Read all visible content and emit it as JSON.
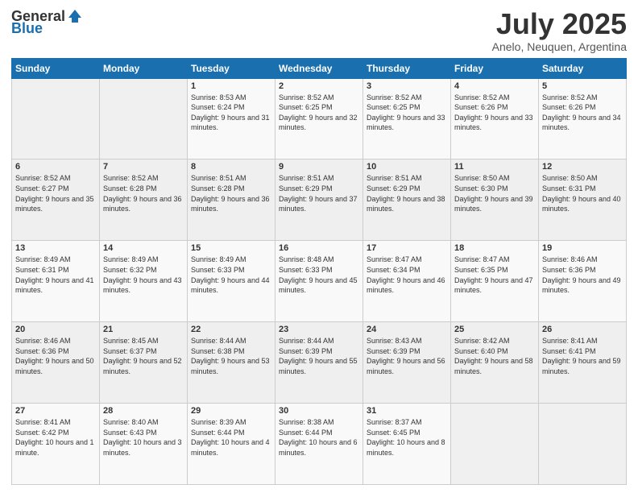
{
  "header": {
    "logo_general": "General",
    "logo_blue": "Blue",
    "title": "July 2025",
    "subtitle": "Anelo, Neuquen, Argentina"
  },
  "weekdays": [
    "Sunday",
    "Monday",
    "Tuesday",
    "Wednesday",
    "Thursday",
    "Friday",
    "Saturday"
  ],
  "weeks": [
    [
      {
        "day": "",
        "info": ""
      },
      {
        "day": "",
        "info": ""
      },
      {
        "day": "1",
        "info": "Sunrise: 8:53 AM\nSunset: 6:24 PM\nDaylight: 9 hours and 31 minutes."
      },
      {
        "day": "2",
        "info": "Sunrise: 8:52 AM\nSunset: 6:25 PM\nDaylight: 9 hours and 32 minutes."
      },
      {
        "day": "3",
        "info": "Sunrise: 8:52 AM\nSunset: 6:25 PM\nDaylight: 9 hours and 33 minutes."
      },
      {
        "day": "4",
        "info": "Sunrise: 8:52 AM\nSunset: 6:26 PM\nDaylight: 9 hours and 33 minutes."
      },
      {
        "day": "5",
        "info": "Sunrise: 8:52 AM\nSunset: 6:26 PM\nDaylight: 9 hours and 34 minutes."
      }
    ],
    [
      {
        "day": "6",
        "info": "Sunrise: 8:52 AM\nSunset: 6:27 PM\nDaylight: 9 hours and 35 minutes."
      },
      {
        "day": "7",
        "info": "Sunrise: 8:52 AM\nSunset: 6:28 PM\nDaylight: 9 hours and 36 minutes."
      },
      {
        "day": "8",
        "info": "Sunrise: 8:51 AM\nSunset: 6:28 PM\nDaylight: 9 hours and 36 minutes."
      },
      {
        "day": "9",
        "info": "Sunrise: 8:51 AM\nSunset: 6:29 PM\nDaylight: 9 hours and 37 minutes."
      },
      {
        "day": "10",
        "info": "Sunrise: 8:51 AM\nSunset: 6:29 PM\nDaylight: 9 hours and 38 minutes."
      },
      {
        "day": "11",
        "info": "Sunrise: 8:50 AM\nSunset: 6:30 PM\nDaylight: 9 hours and 39 minutes."
      },
      {
        "day": "12",
        "info": "Sunrise: 8:50 AM\nSunset: 6:31 PM\nDaylight: 9 hours and 40 minutes."
      }
    ],
    [
      {
        "day": "13",
        "info": "Sunrise: 8:49 AM\nSunset: 6:31 PM\nDaylight: 9 hours and 41 minutes."
      },
      {
        "day": "14",
        "info": "Sunrise: 8:49 AM\nSunset: 6:32 PM\nDaylight: 9 hours and 43 minutes."
      },
      {
        "day": "15",
        "info": "Sunrise: 8:49 AM\nSunset: 6:33 PM\nDaylight: 9 hours and 44 minutes."
      },
      {
        "day": "16",
        "info": "Sunrise: 8:48 AM\nSunset: 6:33 PM\nDaylight: 9 hours and 45 minutes."
      },
      {
        "day": "17",
        "info": "Sunrise: 8:47 AM\nSunset: 6:34 PM\nDaylight: 9 hours and 46 minutes."
      },
      {
        "day": "18",
        "info": "Sunrise: 8:47 AM\nSunset: 6:35 PM\nDaylight: 9 hours and 47 minutes."
      },
      {
        "day": "19",
        "info": "Sunrise: 8:46 AM\nSunset: 6:36 PM\nDaylight: 9 hours and 49 minutes."
      }
    ],
    [
      {
        "day": "20",
        "info": "Sunrise: 8:46 AM\nSunset: 6:36 PM\nDaylight: 9 hours and 50 minutes."
      },
      {
        "day": "21",
        "info": "Sunrise: 8:45 AM\nSunset: 6:37 PM\nDaylight: 9 hours and 52 minutes."
      },
      {
        "day": "22",
        "info": "Sunrise: 8:44 AM\nSunset: 6:38 PM\nDaylight: 9 hours and 53 minutes."
      },
      {
        "day": "23",
        "info": "Sunrise: 8:44 AM\nSunset: 6:39 PM\nDaylight: 9 hours and 55 minutes."
      },
      {
        "day": "24",
        "info": "Sunrise: 8:43 AM\nSunset: 6:39 PM\nDaylight: 9 hours and 56 minutes."
      },
      {
        "day": "25",
        "info": "Sunrise: 8:42 AM\nSunset: 6:40 PM\nDaylight: 9 hours and 58 minutes."
      },
      {
        "day": "26",
        "info": "Sunrise: 8:41 AM\nSunset: 6:41 PM\nDaylight: 9 hours and 59 minutes."
      }
    ],
    [
      {
        "day": "27",
        "info": "Sunrise: 8:41 AM\nSunset: 6:42 PM\nDaylight: 10 hours and 1 minute."
      },
      {
        "day": "28",
        "info": "Sunrise: 8:40 AM\nSunset: 6:43 PM\nDaylight: 10 hours and 3 minutes."
      },
      {
        "day": "29",
        "info": "Sunrise: 8:39 AM\nSunset: 6:44 PM\nDaylight: 10 hours and 4 minutes."
      },
      {
        "day": "30",
        "info": "Sunrise: 8:38 AM\nSunset: 6:44 PM\nDaylight: 10 hours and 6 minutes."
      },
      {
        "day": "31",
        "info": "Sunrise: 8:37 AM\nSunset: 6:45 PM\nDaylight: 10 hours and 8 minutes."
      },
      {
        "day": "",
        "info": ""
      },
      {
        "day": "",
        "info": ""
      }
    ]
  ]
}
